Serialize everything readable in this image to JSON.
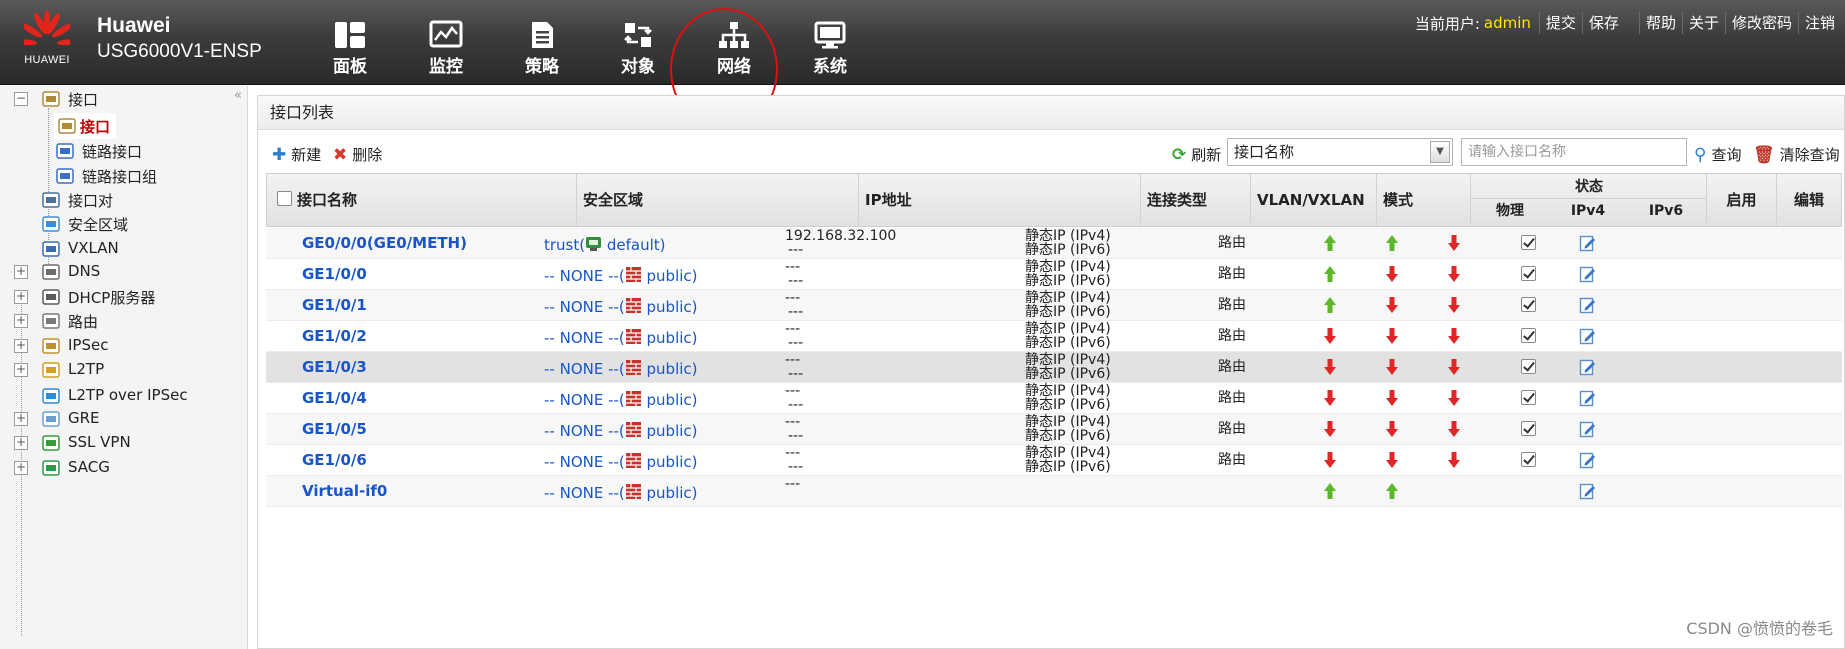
{
  "brand": {
    "logo_text": "HUAWEI",
    "name": "Huawei",
    "model": "USG6000V1-ENSP"
  },
  "main_nav": [
    {
      "label": "面板",
      "icon": "dashboard-icon"
    },
    {
      "label": "监控",
      "icon": "monitor-icon"
    },
    {
      "label": "策略",
      "icon": "policy-icon"
    },
    {
      "label": "对象",
      "icon": "object-icon"
    },
    {
      "label": "网络",
      "icon": "network-icon",
      "active": true
    },
    {
      "label": "系统",
      "icon": "system-icon"
    }
  ],
  "user_nav": {
    "current_user_label": "当前用户:",
    "current_user": "admin",
    "links": [
      "提交",
      "保存",
      "帮助",
      "关于",
      "修改密码",
      "注销"
    ]
  },
  "sidebar": {
    "collapse_glyph": "«",
    "items": [
      {
        "label": "接口",
        "icon": "interface-icon",
        "expander": "−",
        "level": 0
      },
      {
        "label": "接口",
        "icon": "interface-icon",
        "level": 1,
        "selected": true
      },
      {
        "label": "链路接口",
        "icon": "link-icon",
        "level": 1
      },
      {
        "label": "链路接口组",
        "icon": "link-group-icon",
        "level": 1
      },
      {
        "label": "接口对",
        "icon": "interface-pair-icon",
        "level": 0
      },
      {
        "label": "安全区域",
        "icon": "security-zone-icon",
        "level": 0
      },
      {
        "label": "VXLAN",
        "icon": "vxlan-icon",
        "level": 0
      },
      {
        "label": "DNS",
        "icon": "dns-icon",
        "expander": "+",
        "level": 0
      },
      {
        "label": "DHCP服务器",
        "icon": "dhcp-icon",
        "expander": "+",
        "level": 0
      },
      {
        "label": "路由",
        "icon": "route-icon",
        "expander": "+",
        "level": 0
      },
      {
        "label": "IPSec",
        "icon": "ipsec-icon",
        "expander": "+",
        "level": 0
      },
      {
        "label": "L2TP",
        "icon": "l2tp-icon",
        "expander": "+",
        "level": 0
      },
      {
        "label": "L2TP over IPSec",
        "icon": "l2tp-ipsec-icon",
        "level": 0
      },
      {
        "label": "GRE",
        "icon": "gre-icon",
        "expander": "+",
        "level": 0
      },
      {
        "label": "SSL VPN",
        "icon": "sslvpn-icon",
        "expander": "+",
        "level": 0
      },
      {
        "label": "SACG",
        "icon": "sacg-icon",
        "expander": "+",
        "level": 0
      }
    ]
  },
  "panel": {
    "title": "接口列表",
    "toolbar": {
      "new_label": "新建",
      "delete_label": "删除",
      "refresh_label": "刷新",
      "filter_field": "接口名称",
      "search_placeholder": "请输入接口名称",
      "query_label": "查询",
      "clear_query_label": "清除查询"
    },
    "columns": {
      "name": "接口名称",
      "zone": "安全区域",
      "ip": "IP地址",
      "conn_type": "连接类型",
      "vlan": "VLAN/VXLAN",
      "mode": "模式",
      "status": "状态",
      "status_physical": "物理",
      "status_ipv4": "IPv4",
      "status_ipv6": "IPv6",
      "enable": "启用",
      "edit": "编辑"
    },
    "rows": [
      {
        "name": "GE0/0/0(GE0/METH)",
        "zone_prefix": "trust(",
        "zone_vsys": "default)",
        "ip1": "192.168.32.100",
        "ip2": "---",
        "conn1": "静态IP (IPv4)",
        "conn2": "静态IP (IPv6)",
        "mode": "路由",
        "phys": "up",
        "ipv4": "up",
        "ipv6": "down",
        "enabled": true
      },
      {
        "name": "GE1/0/0",
        "zone_prefix": "-- NONE --(",
        "zone_vsys": "public)",
        "ip1": "---",
        "ip2": "---",
        "conn1": "静态IP (IPv4)",
        "conn2": "静态IP (IPv6)",
        "mode": "路由",
        "phys": "up",
        "ipv4": "down",
        "ipv6": "down",
        "enabled": true
      },
      {
        "name": "GE1/0/1",
        "zone_prefix": "-- NONE --(",
        "zone_vsys": "public)",
        "ip1": "---",
        "ip2": "---",
        "conn1": "静态IP (IPv4)",
        "conn2": "静态IP (IPv6)",
        "mode": "路由",
        "phys": "up",
        "ipv4": "down",
        "ipv6": "down",
        "enabled": true
      },
      {
        "name": "GE1/0/2",
        "zone_prefix": "-- NONE --(",
        "zone_vsys": "public)",
        "ip1": "---",
        "ip2": "---",
        "conn1": "静态IP (IPv4)",
        "conn2": "静态IP (IPv6)",
        "mode": "路由",
        "phys": "down",
        "ipv4": "down",
        "ipv6": "down",
        "enabled": true
      },
      {
        "name": "GE1/0/3",
        "zone_prefix": "-- NONE --(",
        "zone_vsys": "public)",
        "ip1": "---",
        "ip2": "---",
        "conn1": "静态IP (IPv4)",
        "conn2": "静态IP (IPv6)",
        "mode": "路由",
        "phys": "down",
        "ipv4": "down",
        "ipv6": "down",
        "enabled": true
      },
      {
        "name": "GE1/0/4",
        "zone_prefix": "-- NONE --(",
        "zone_vsys": "public)",
        "ip1": "---",
        "ip2": "---",
        "conn1": "静态IP (IPv4)",
        "conn2": "静态IP (IPv6)",
        "mode": "路由",
        "phys": "down",
        "ipv4": "down",
        "ipv6": "down",
        "enabled": true
      },
      {
        "name": "GE1/0/5",
        "zone_prefix": "-- NONE --(",
        "zone_vsys": "public)",
        "ip1": "---",
        "ip2": "---",
        "conn1": "静态IP (IPv4)",
        "conn2": "静态IP (IPv6)",
        "mode": "路由",
        "phys": "down",
        "ipv4": "down",
        "ipv6": "down",
        "enabled": true
      },
      {
        "name": "GE1/0/6",
        "zone_prefix": "-- NONE --(",
        "zone_vsys": "public)",
        "ip1": "---",
        "ip2": "---",
        "conn1": "静态IP (IPv4)",
        "conn2": "静态IP (IPv6)",
        "mode": "路由",
        "phys": "down",
        "ipv4": "down",
        "ipv6": "down",
        "enabled": true
      },
      {
        "name": "Virtual-if0",
        "zone_prefix": "-- NONE --(",
        "zone_vsys": "public)",
        "ip1": "---",
        "ip2": "",
        "conn1": "",
        "conn2": "",
        "mode": "",
        "phys": "up",
        "ipv4": "up",
        "ipv6": "",
        "enabled": false
      }
    ]
  },
  "watermark": "CSDN @愤愤的卷毛",
  "colors": {
    "link": "#1a55c8",
    "status_up": "#5cb82a",
    "status_down": "#e02626",
    "selected_item": "#c00000",
    "user_name": "#ffe600"
  }
}
